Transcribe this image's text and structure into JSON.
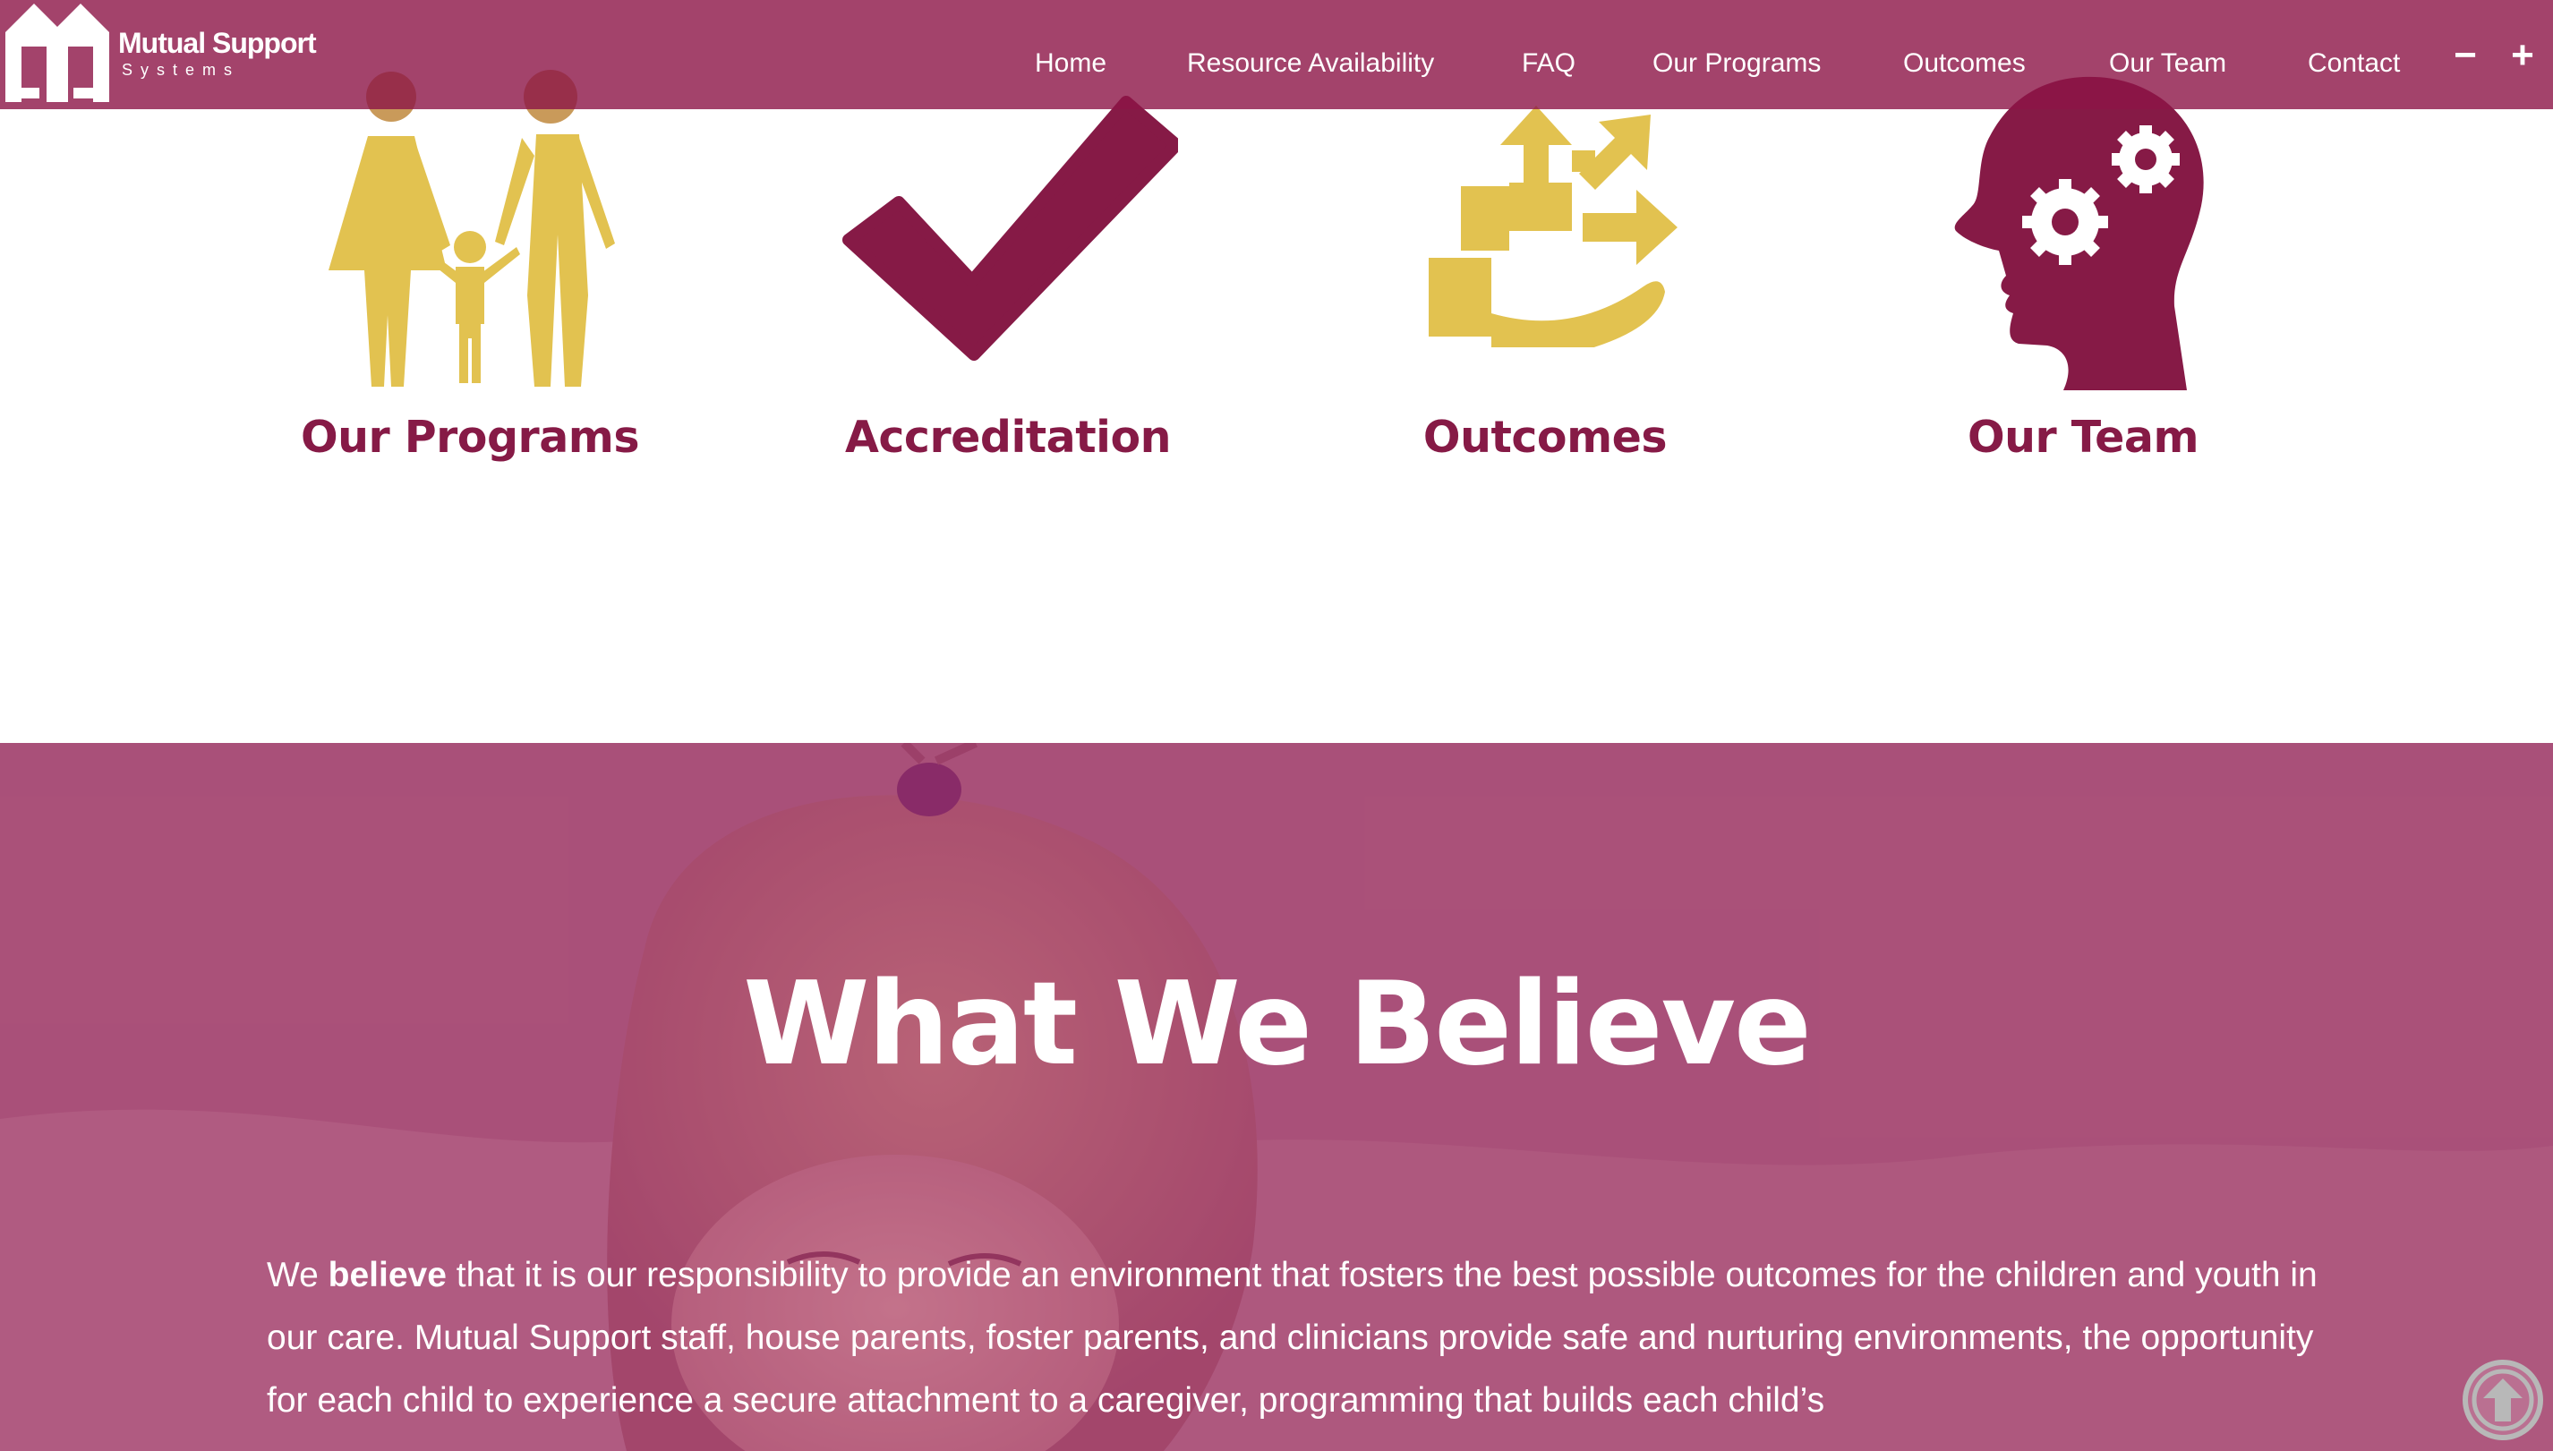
{
  "header": {
    "logo": {
      "name": "Mutual Support",
      "sub": "Systems"
    },
    "nav": [
      {
        "label": "Home"
      },
      {
        "label": "Resource Availability"
      },
      {
        "label": "FAQ"
      },
      {
        "label": "Our Programs"
      },
      {
        "label": "Outcomes"
      },
      {
        "label": "Our Team"
      },
      {
        "label": "Contact"
      }
    ],
    "zoom_out": "−",
    "zoom_in": "+"
  },
  "features": [
    {
      "label": "Our Programs",
      "icon": "family-icon",
      "color": "#e2c250"
    },
    {
      "label": "Accreditation",
      "icon": "checkmark-icon",
      "color": "#861a46"
    },
    {
      "label": "Outcomes",
      "icon": "growth-hand-icon",
      "color": "#e2c250"
    },
    {
      "label": "Our Team",
      "icon": "head-gears-icon",
      "color": "#861a46"
    }
  ],
  "belief": {
    "title": "What We Believe",
    "text_prefix": "We ",
    "text_bold": "believe",
    "text_rest": " that it is our responsibility to provide an environment that fosters the best possible outcomes for the children and youth in our care. Mutual Support staff, house parents, foster parents, and clinicians provide safe and nurturing environments, the opportunity for each child to experience a secure attachment to a caregiver, programming that builds each child’s"
  },
  "colors": {
    "brand": "#861a46",
    "accent": "#e2c250",
    "header_bg": "#9c4a6b"
  }
}
